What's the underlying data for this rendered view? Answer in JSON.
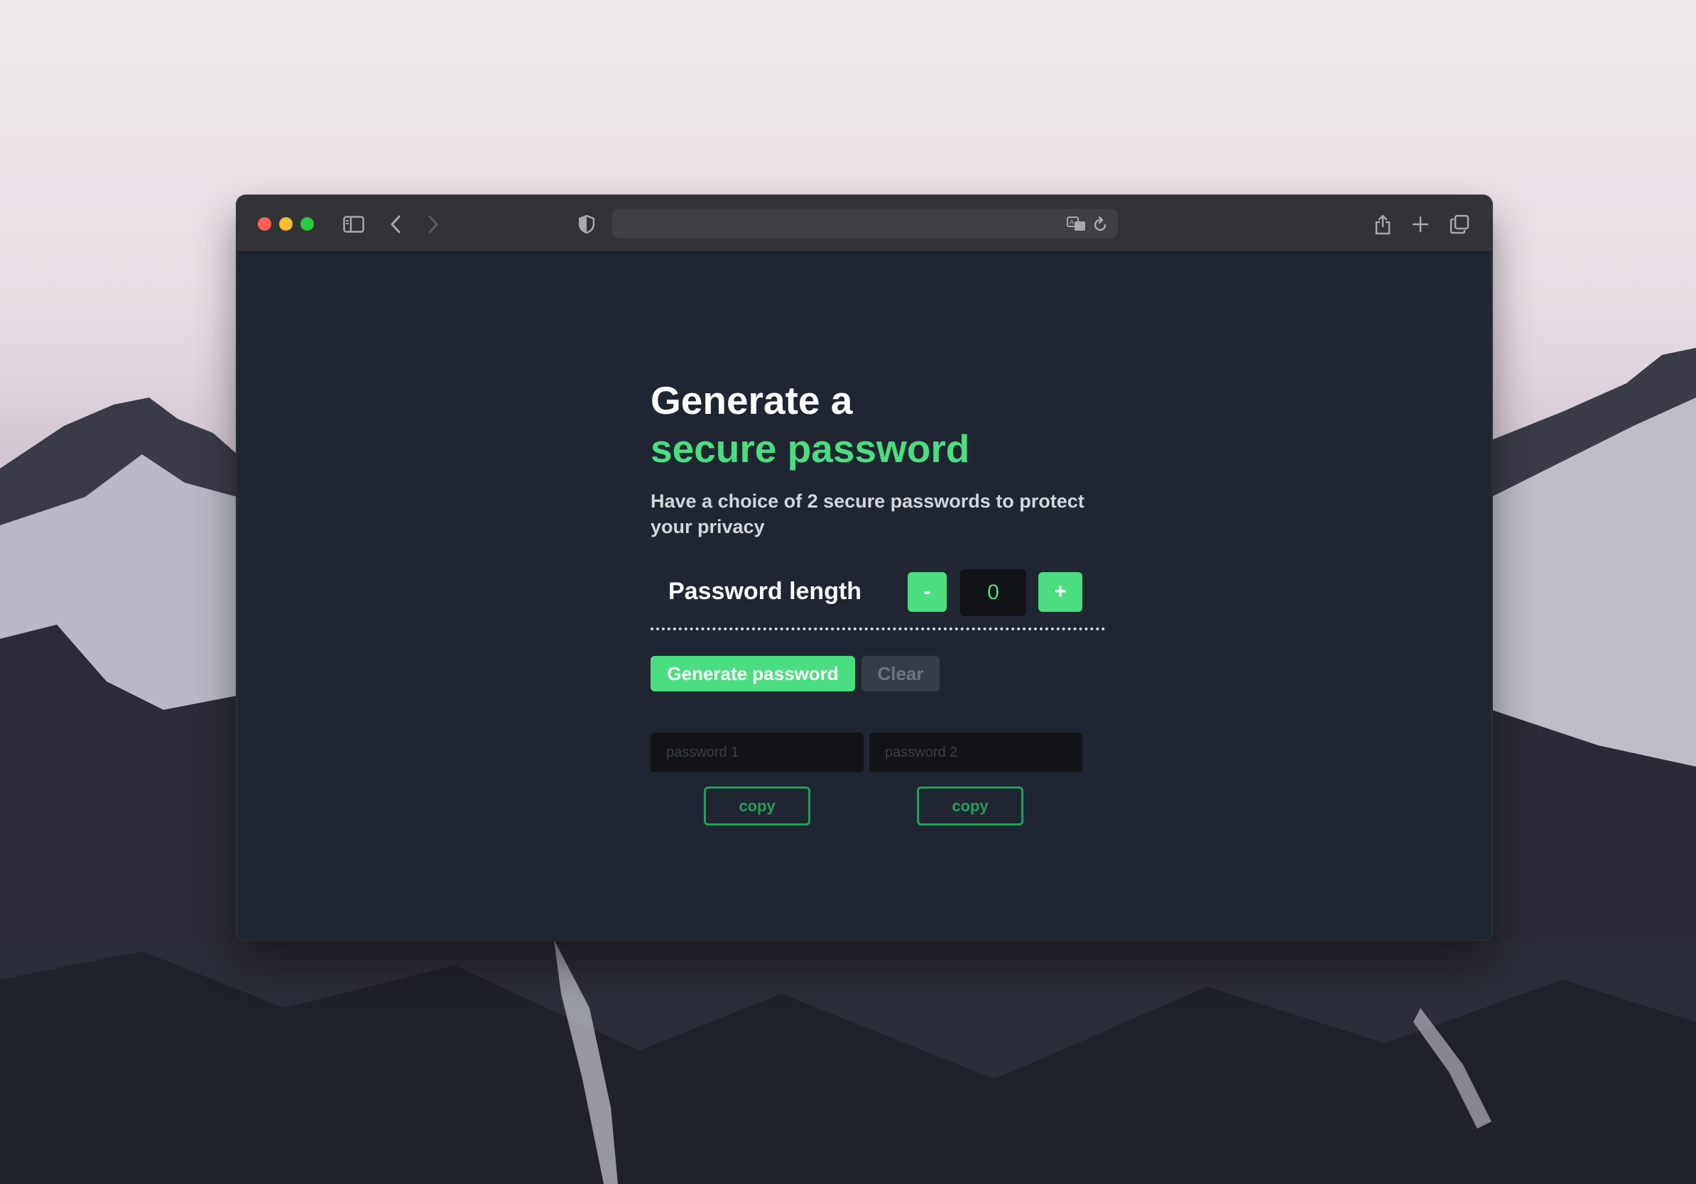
{
  "browser": {
    "icons": {
      "sidebar": "sidebar-icon",
      "back": "chevron-left-icon",
      "forward": "chevron-right-icon",
      "privacy": "shield-icon",
      "translate": "translate-icon",
      "reload": "reload-icon",
      "share": "share-icon",
      "new_tab": "plus-icon",
      "tabs": "tabs-overview-icon"
    },
    "address": ""
  },
  "app": {
    "title_line1": "Generate a",
    "title_line2": "secure password",
    "subtitle": "Have a choice of 2 secure passwords to protect your privacy",
    "length_label": "Password length",
    "minus_label": "-",
    "plus_label": "+",
    "length_value": "0",
    "generate_label": "Generate password",
    "clear_label": "Clear",
    "password1_placeholder": "password 1",
    "password2_placeholder": "password 2",
    "copy1_label": "copy",
    "copy2_label": "copy"
  },
  "colors": {
    "accent": "#4ade80",
    "copy_accent": "#22a05b",
    "background": "#1f2632",
    "input_bg": "#111317"
  }
}
